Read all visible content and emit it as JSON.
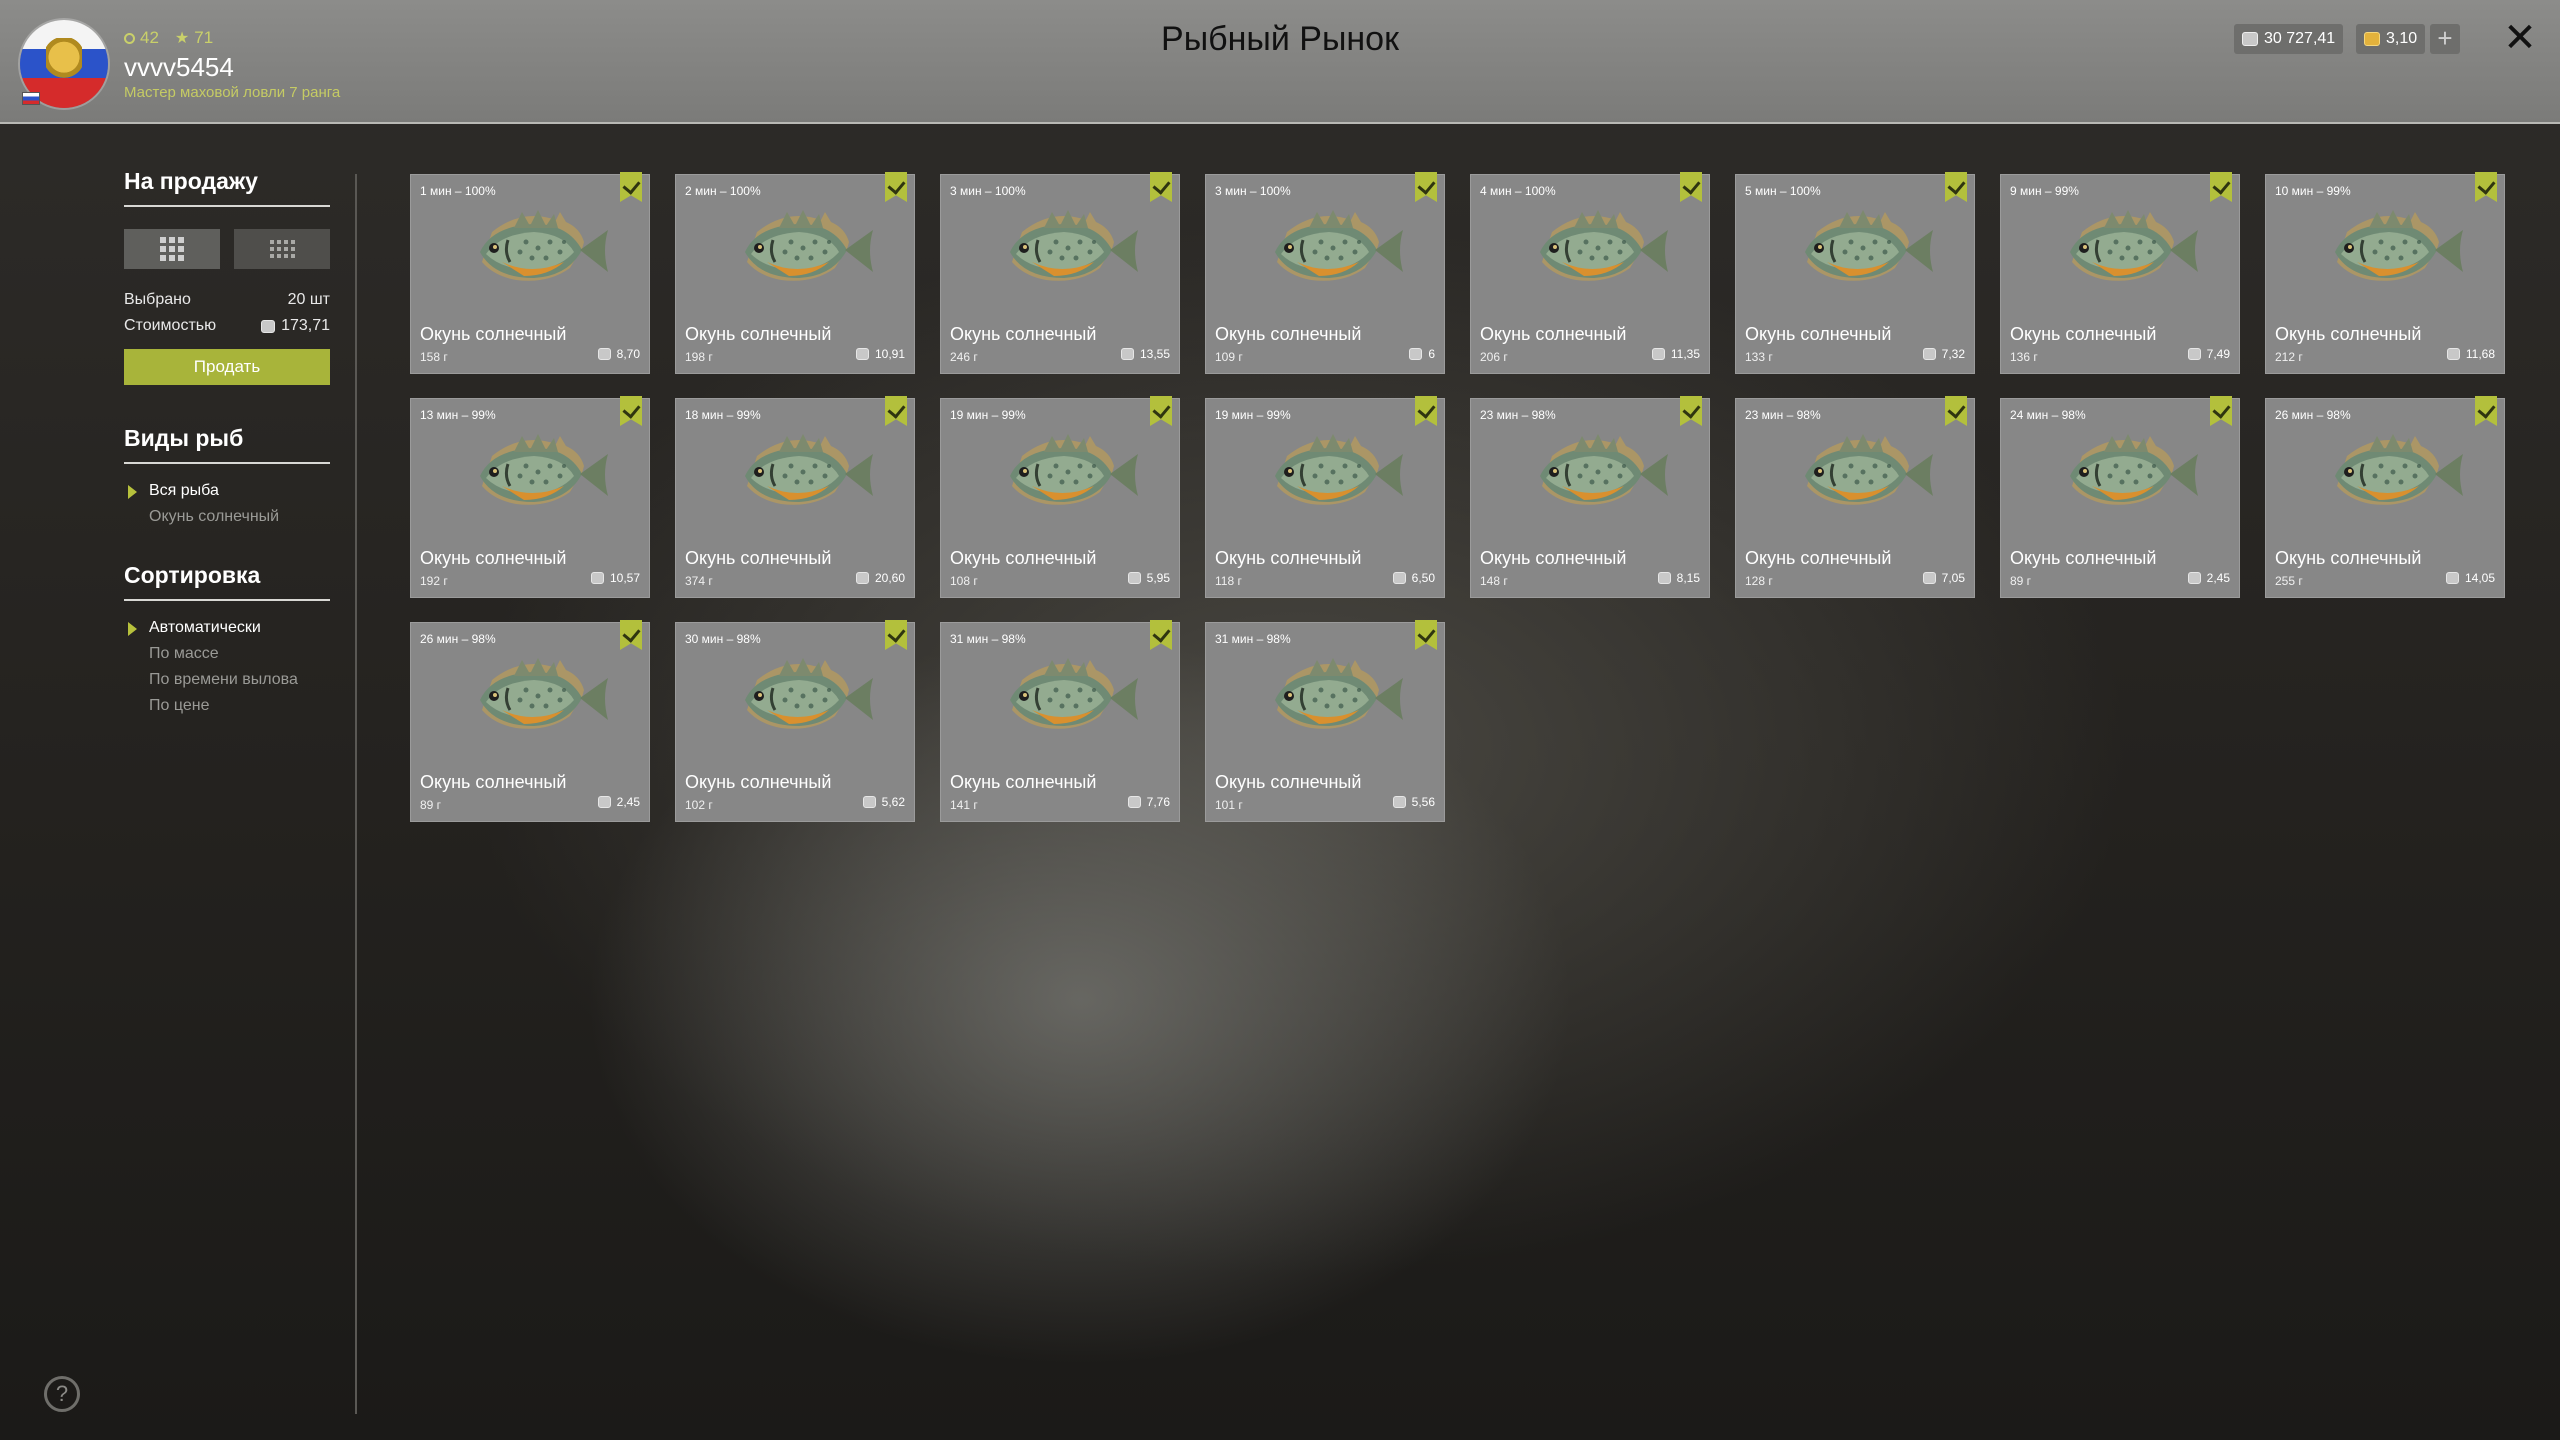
{
  "header": {
    "title": "Рыбный Рынок",
    "level": "42",
    "stars": "71",
    "username": "vvvv5454",
    "rank": "Мастер маховой ловли 7 ранга",
    "silver": "30 727,41",
    "gold": "3,10",
    "plus": "+",
    "close": "✕"
  },
  "sidebar": {
    "for_sale_title": "На продажу",
    "selected_label": "Выбрано",
    "selected_value": "20 шт",
    "cost_label": "Стоимостью",
    "cost_value": "173,71",
    "sell_label": "Продать",
    "species_title": "Виды рыб",
    "species": [
      "Вся рыба",
      "Окунь солнечный"
    ],
    "sort_title": "Сортировка",
    "sort_options": [
      "Автоматически",
      "По массе",
      "По времени вылова",
      "По цене"
    ]
  },
  "help": "?",
  "colors": {
    "accent": "#a8b43a",
    "card": "#878787"
  },
  "fish": [
    {
      "time": "1 мин – 100%",
      "name": "Окунь солнечный",
      "weight": "158 г",
      "price": "8,70"
    },
    {
      "time": "2 мин – 100%",
      "name": "Окунь солнечный",
      "weight": "198 г",
      "price": "10,91"
    },
    {
      "time": "3 мин – 100%",
      "name": "Окунь солнечный",
      "weight": "246 г",
      "price": "13,55"
    },
    {
      "time": "3 мин – 100%",
      "name": "Окунь солнечный",
      "weight": "109 г",
      "price": "6"
    },
    {
      "time": "4 мин – 100%",
      "name": "Окунь солнечный",
      "weight": "206 г",
      "price": "11,35"
    },
    {
      "time": "5 мин – 100%",
      "name": "Окунь солнечный",
      "weight": "133 г",
      "price": "7,32"
    },
    {
      "time": "9 мин – 99%",
      "name": "Окунь солнечный",
      "weight": "136 г",
      "price": "7,49"
    },
    {
      "time": "10 мин – 99%",
      "name": "Окунь солнечный",
      "weight": "212 г",
      "price": "11,68"
    },
    {
      "time": "13 мин – 99%",
      "name": "Окунь солнечный",
      "weight": "192 г",
      "price": "10,57"
    },
    {
      "time": "18 мин – 99%",
      "name": "Окунь солнечный",
      "weight": "374 г",
      "price": "20,60"
    },
    {
      "time": "19 мин – 99%",
      "name": "Окунь солнечный",
      "weight": "108 г",
      "price": "5,95"
    },
    {
      "time": "19 мин – 99%",
      "name": "Окунь солнечный",
      "weight": "118 г",
      "price": "6,50"
    },
    {
      "time": "23 мин – 98%",
      "name": "Окунь солнечный",
      "weight": "148 г",
      "price": "8,15"
    },
    {
      "time": "23 мин – 98%",
      "name": "Окунь солнечный",
      "weight": "128 г",
      "price": "7,05"
    },
    {
      "time": "24 мин – 98%",
      "name": "Окунь солнечный",
      "weight": "89 г",
      "price": "2,45"
    },
    {
      "time": "26 мин – 98%",
      "name": "Окунь солнечный",
      "weight": "255 г",
      "price": "14,05"
    },
    {
      "time": "26 мин – 98%",
      "name": "Окунь солнечный",
      "weight": "89 г",
      "price": "2,45"
    },
    {
      "time": "30 мин – 98%",
      "name": "Окунь солнечный",
      "weight": "102 г",
      "price": "5,62"
    },
    {
      "time": "31 мин – 98%",
      "name": "Окунь солнечный",
      "weight": "141 г",
      "price": "7,76"
    },
    {
      "time": "31 мин – 98%",
      "name": "Окунь солнечный",
      "weight": "101 г",
      "price": "5,56"
    }
  ]
}
